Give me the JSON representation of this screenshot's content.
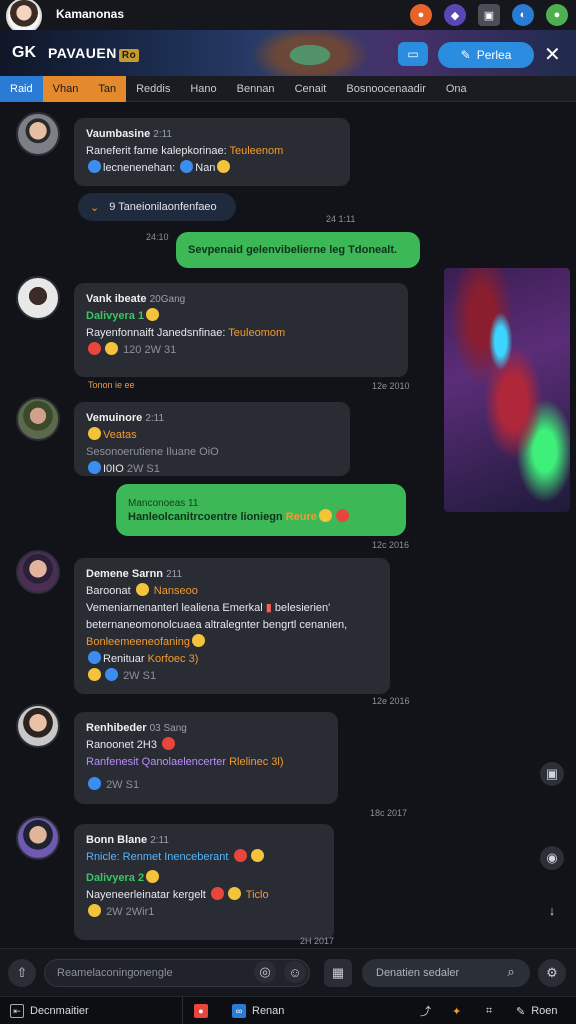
{
  "titlebar": {
    "title": "Kamanonas",
    "icons": [
      "orange-circle-icon",
      "shield-icon",
      "window-icon",
      "chat-icon",
      "green-avatar-icon"
    ]
  },
  "banner": {
    "brand_icon": "GK",
    "brand_name": "PAVAUEN",
    "brand_tag": "Ro",
    "chat_button_icon": "chat-icon",
    "primary_button": "Perlea",
    "close_icon": "close-icon"
  },
  "tabs": [
    "Raid",
    "Vhan",
    "Tan",
    "Reddis",
    "Hano",
    "Bennan",
    "Cenait",
    "Bosnoocenaadir",
    "Ona"
  ],
  "messages": [
    {
      "name": "Vaumbasine",
      "meta": "2:11",
      "line1_prefix": "Raneferit fame kalepkorinae:",
      "line1_suffix": "Teuleenom",
      "line2": "lecnenenehan:",
      "line2_tail": "Nan"
    },
    {
      "reply_pill": "9 Taneionilaonfenfaeo",
      "time": "24 1:11",
      "outgoing_time": "24:10",
      "outgoing_text": "Sevpenaid gelenvibelierne leg Tdonealt."
    },
    {
      "name": "Vank ibeate",
      "meta": "20Gang",
      "green_line": "Dalivyera 1",
      "line1_prefix": "Rayenfonnaift Janedsnfinae:",
      "line1_suffix": "Teuleomom",
      "foot": "120 2W 31",
      "time": "12e 2010",
      "under": "Tonon ie ee"
    },
    {
      "name": "Vemuinore",
      "meta": "2:11",
      "orange_line": "Veatas",
      "grey_line": "Sesonoerutiene Iluane OiO",
      "foot": "I0IO",
      "foot2": "2W S1"
    },
    {
      "outgoing_head": "Manconoeas",
      "outgoing_head_meta": "11",
      "outgoing_text": "Hanleolcanitrcoentre lioniegn",
      "outgoing_tail": "Reure",
      "time": "12c 2016"
    },
    {
      "name": "Demene Sarnn",
      "meta": "211",
      "line1_prefix": "Baroonat",
      "line1_suffix": "Nanseoo",
      "line2": "Vemeniarnenanterl",
      "line2_mid": "lealiena Emerkal",
      "line2_tail": "belesierien'",
      "line3": "beternaneomonolcuaea altralegnter bengrtl cenanien,",
      "line4": "Bonleemeeneofaning",
      "line5_prefix": "Renituar",
      "line5_suffix": "Korfoec 3)",
      "foot": "2W S1",
      "time": "12e 2016"
    },
    {
      "name": "Renhibeder",
      "meta": "03 Sang",
      "line1": "Ranoonet 2H3",
      "line2": "Ranfenesit Qanolaelencerter",
      "line2_tail": "Rlelinec 3l)",
      "foot": "2W S1",
      "time": "18c 2017"
    },
    {
      "name": "Bonn Blane",
      "meta": "2:11",
      "line1": "Rnicle: Renmet Inenceberant",
      "green_line": "Dalivyera 2",
      "line3_prefix": "Nayeneerleinatar kergelt",
      "line3_suffix": "Ticlo",
      "foot": "2W 2Wir1",
      "time": "2H 2017"
    }
  ],
  "composer": {
    "placeholder": "Reamelaconingonengle",
    "search_placeholder": "Denatien sedaler"
  },
  "taskbar": {
    "app_label": "Decnmaitier",
    "item2": "Renan",
    "item3": "Roen"
  }
}
